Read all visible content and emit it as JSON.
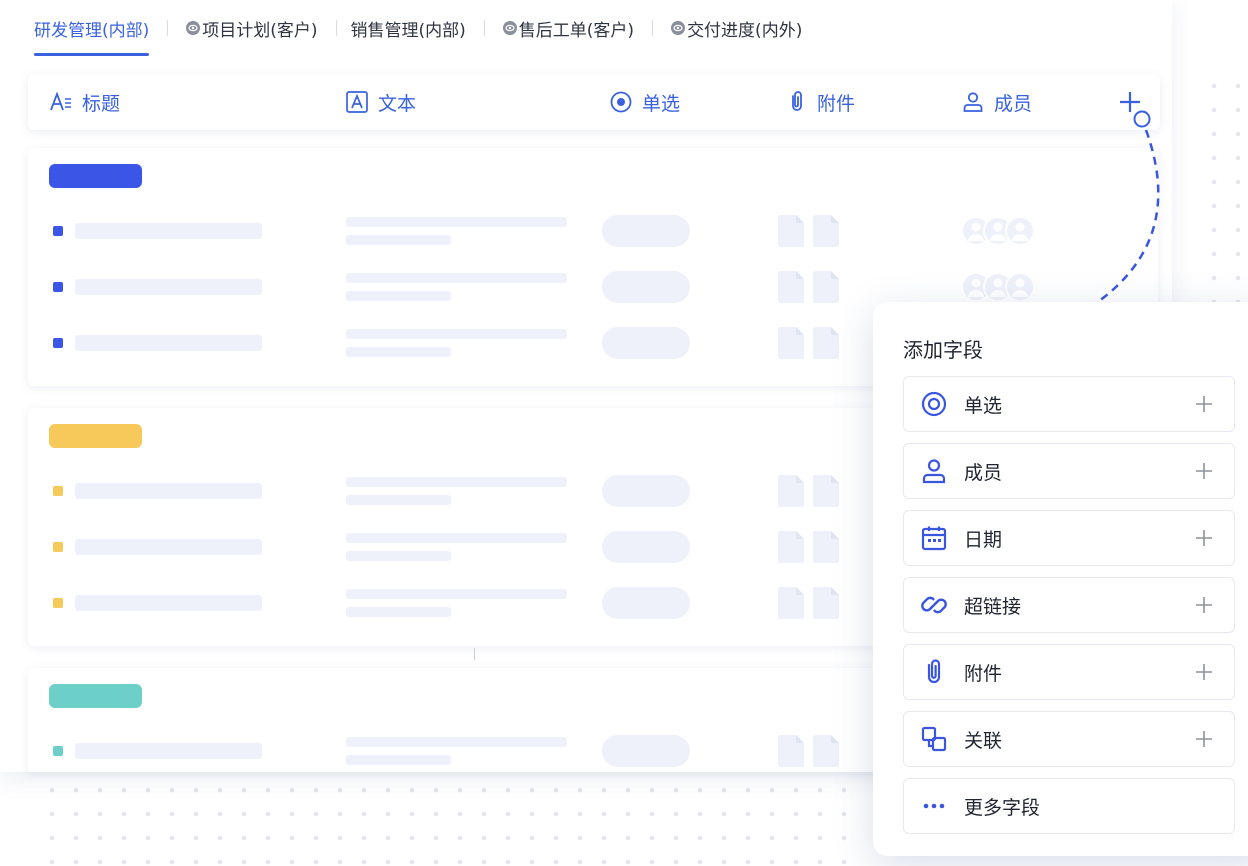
{
  "tabs": [
    {
      "label": "研发管理(内部)",
      "active": true,
      "has_eye": false
    },
    {
      "label": "项目计划(客户)",
      "active": false,
      "has_eye": true
    },
    {
      "label": "销售管理(内部)",
      "active": false,
      "has_eye": false
    },
    {
      "label": "售后工单(客户)",
      "active": false,
      "has_eye": true
    },
    {
      "label": "交付进度(内外)",
      "active": false,
      "has_eye": true
    }
  ],
  "columns": {
    "title": "标题",
    "text": "文本",
    "single_select": "单选",
    "attachment": "附件",
    "member": "成员"
  },
  "groups": [
    {
      "color": "#3b55e6",
      "rows": 3
    },
    {
      "color": "#f7c85a",
      "rows": 3
    },
    {
      "color": "#6ccfc8",
      "rows": 1
    }
  ],
  "popup": {
    "title": "添加字段",
    "items": [
      {
        "label": "单选",
        "icon": "radio-icon"
      },
      {
        "label": "成员",
        "icon": "user-icon"
      },
      {
        "label": "日期",
        "icon": "calendar-icon"
      },
      {
        "label": "超链接",
        "icon": "link-icon"
      },
      {
        "label": "附件",
        "icon": "paperclip-icon"
      },
      {
        "label": "关联",
        "icon": "relation-icon"
      },
      {
        "label": "更多字段",
        "icon": "more-icon"
      }
    ]
  },
  "colors": {
    "accent": "#3a62e0",
    "placeholder": "#eef1fa"
  }
}
